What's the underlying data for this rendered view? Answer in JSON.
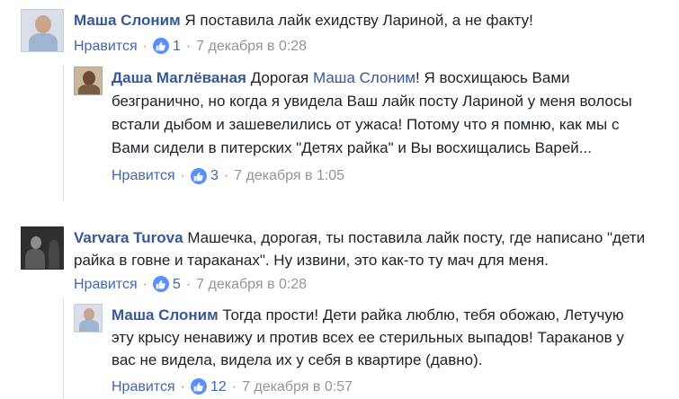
{
  "comments": [
    {
      "author": "Маша Слоним",
      "text": " Я поставила лайк ехидству Лариной, а не факту!",
      "like_label": "Нравится",
      "like_count": "1",
      "date": "7 декабря в 0:28"
    },
    {
      "author": "Даша Маглёваная",
      "text_before": " Дорогая ",
      "mention": "Маша Слоним",
      "text_after": "! Я восхищаюсь Вами безгранично, но когда я увидела Ваш лайк посту Лариной у меня волосы встали дыбом и зашевелились от ужаса! Потому что я помню, как мы с Вами сидели в питерских \"Детях райка\" и Вы восхищались Варей...",
      "like_label": "Нравится",
      "like_count": "3",
      "date": "7 декабря в 1:05"
    },
    {
      "author": "Varvara Turova",
      "text": " Машечка, дорогая, ты поставила лайк посту, где написано \"дети райка в говне и тараканах\". Ну извини, это как-то ту мач для меня.",
      "like_label": "Нравится",
      "like_count": "5",
      "date": "7 декабря в 0:28"
    },
    {
      "author": "Маша Слоним",
      "text": " Тогда прости! Дети райка люблю, тебя обожаю, Летучую эту крысу ненавижу и против всех ее стерильных выпадов! Тараканов у вас не видела, видела их у себя в квартире (давно).",
      "like_label": "Нравится",
      "like_count": "12",
      "date": "7 декабря в 0:57"
    }
  ],
  "separator": "·",
  "colors": {
    "link": "#365899",
    "text": "#1d2129",
    "muted": "#90949c",
    "like_blue": "#5890ff"
  }
}
